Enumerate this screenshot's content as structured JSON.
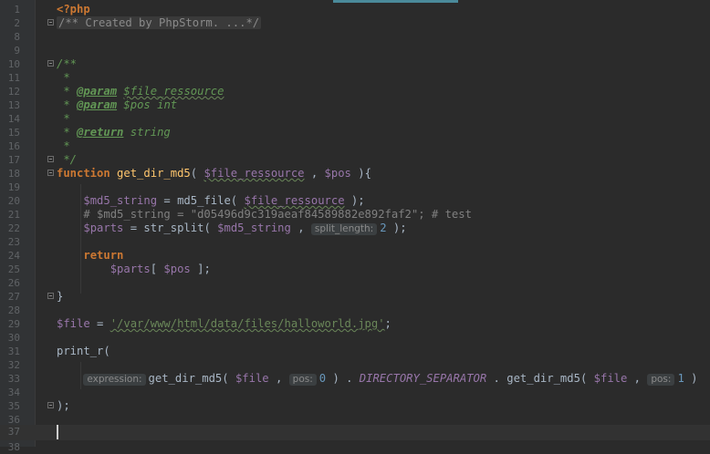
{
  "lines": [
    {
      "n": "1",
      "t": "<?php"
    },
    {
      "n": "2",
      "t": "/** Created by PhpStorm. ...*/"
    },
    {
      "n": "8",
      "t": ""
    },
    {
      "n": "9",
      "t": ""
    },
    {
      "n": "10",
      "t": "/**"
    },
    {
      "n": "11",
      "t": " *"
    },
    {
      "n": "12",
      "t": " * @param $file_ressource"
    },
    {
      "n": "13",
      "t": " * @param $pos int"
    },
    {
      "n": "14",
      "t": " *"
    },
    {
      "n": "15",
      "t": " * @return string"
    },
    {
      "n": "16",
      "t": " *"
    },
    {
      "n": "17",
      "t": " */"
    },
    {
      "n": "18",
      "t": "function get_dir_md5( $file_ressource , $pos ){"
    },
    {
      "n": "19",
      "t": ""
    },
    {
      "n": "20",
      "t": "    $md5_string = md5_file( $file_ressource );"
    },
    {
      "n": "21",
      "t": "    # $md5_string = \"d05496d9c319aeaf84589882e892faf2\"; # test"
    },
    {
      "n": "22",
      "t": "    $parts = str_split( $md5_string , split_length: 2 );"
    },
    {
      "n": "23",
      "t": ""
    },
    {
      "n": "24",
      "t": "    return"
    },
    {
      "n": "25",
      "t": "        $parts[ $pos ];"
    },
    {
      "n": "26",
      "t": ""
    },
    {
      "n": "27",
      "t": "}"
    },
    {
      "n": "28",
      "t": ""
    },
    {
      "n": "29",
      "t": "$file = '/var/www/html/data/files/halloworld.jpg';"
    },
    {
      "n": "30",
      "t": ""
    },
    {
      "n": "31",
      "t": "print_r("
    },
    {
      "n": "32",
      "t": ""
    },
    {
      "n": "33",
      "t": "    expression: get_dir_md5( $file , pos: 0 ) . DIRECTORY_SEPARATOR . get_dir_md5( $file , pos: 1 )"
    },
    {
      "n": "34",
      "t": ""
    },
    {
      "n": "35",
      "t": ");"
    },
    {
      "n": "36",
      "t": ""
    },
    {
      "n": "37",
      "t": ""
    },
    {
      "n": "38",
      "t": ""
    }
  ],
  "tokens": {
    "php_open": "<?php",
    "collapsed_header": "/** Created by PhpStorm. ...*/",
    "doc_open": "/**",
    "star": " *",
    "doc_close": " */",
    "param_tag": "@param",
    "return_tag": "@return",
    "param1": "$file_ressource",
    "param2": "$pos",
    "type_int": "int",
    "type_string": "string",
    "kw_function": "function",
    "fn_name": "get_dir_md5",
    "var_file_ressource": "$file_ressource",
    "var_pos": "$pos",
    "var_md5": "$md5_string",
    "fn_md5_file": "md5_file",
    "comment_21": "# $md5_string = \"d05496d9c319aeaf84589882e892faf2\"; # test",
    "var_parts": "$parts",
    "fn_str_split": "str_split",
    "hint_split_length": "split_length:",
    "num_2": "2",
    "kw_return": "return",
    "var_file": "$file",
    "str_path": "'/var/www/html/data/files/halloworld.jpg'",
    "fn_print_r": "print_r",
    "hint_expression": "expression:",
    "hint_pos": "pos:",
    "num_0": "0",
    "num_1": "1",
    "const_dir_sep": "DIRECTORY_SEPARATOR"
  },
  "colors": {
    "background": "#2b2b2b",
    "gutter": "#313335",
    "keyword": "#cc7832",
    "variable": "#9876aa",
    "string": "#6a8759",
    "number": "#6897bb",
    "doc": "#629755",
    "comment": "#808080"
  }
}
